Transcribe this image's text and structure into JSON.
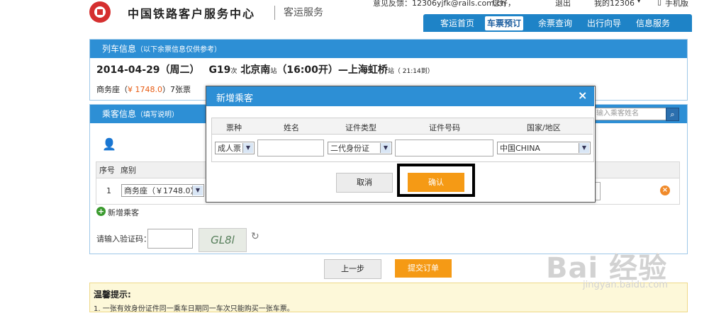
{
  "header": {
    "feedback_text": "意见反馈：12306yjfk@rails.com.cn",
    "greeting": "您好，",
    "logout": "退出",
    "my_account": "我的12306",
    "mobile": "手机版",
    "brand": "中国铁路客户服务中心",
    "brand_sub": "客运服务",
    "nav": [
      "客运首页",
      "车票预订",
      "余票查询",
      "出行向导",
      "信息服务"
    ]
  },
  "train_panel": {
    "title": "列车信息",
    "title_note": "（以下余票信息仅供参考）",
    "date": "2014-04-29（周二）",
    "train_no": "G19",
    "train_suffix": "次",
    "from": "北京南",
    "station_suffix": "站",
    "depart": "（16:00开）",
    "dash": "—",
    "to": "上海虹桥",
    "arrive": "（ 21:14到）",
    "seat_label": "商务座（",
    "seat_price": "¥ 1748.0",
    "seat_rest": "）7张票"
  },
  "passenger_panel": {
    "title": "乘客信息",
    "title_note": "（填写说明）",
    "search_placeholder": "输入乘客姓名",
    "col_no": "序号",
    "col_seat": "席别",
    "row_no": "1",
    "row_seat": "商务座（￥1748.0）",
    "add_passenger": "新增乘客",
    "captcha_label": "请输入验证码：",
    "captcha_text": "GL8l"
  },
  "actions": {
    "prev": "上一步",
    "submit": "提交订单"
  },
  "tips": {
    "title": "温馨提示:",
    "line1": "1.   一张有效身份证件同一乘车日期同一车次只能购买一张车票。"
  },
  "modal": {
    "title": "新增乘客",
    "close": "×",
    "headers": [
      "票种",
      "姓名",
      "证件类型",
      "证件号码",
      "国家/地区"
    ],
    "ticket_type": "成人票",
    "name_value": "",
    "id_type": "二代身份证",
    "id_number": "",
    "country": "中国CHINA",
    "cancel": "取消",
    "confirm": "确认"
  },
  "watermark": {
    "brand": "Bai 经验",
    "url": "jingyan.baidu.com"
  },
  "colors": {
    "primary_blue": "#2d8fd5",
    "nav_blue": "#1e83c7",
    "orange": "#f59a15",
    "logo_red": "#d52f2f"
  }
}
